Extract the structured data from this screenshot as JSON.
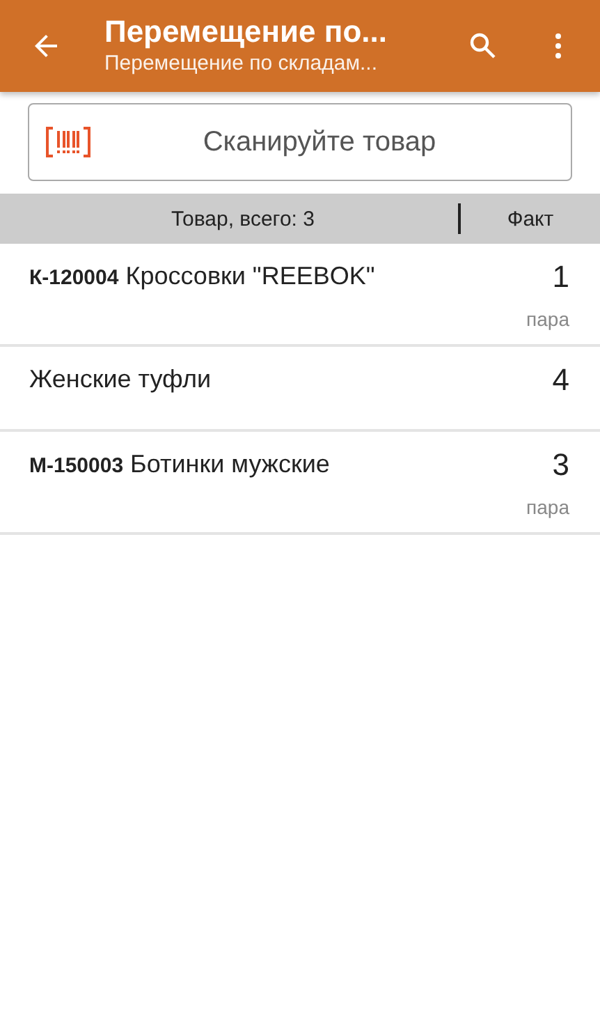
{
  "app_bar": {
    "title": "Перемещение по...",
    "subtitle": "Перемещение по складам..."
  },
  "scan_field": {
    "placeholder": "Сканируйте товар"
  },
  "table": {
    "columns": [
      "Товар, всего: 3",
      "Факт"
    ],
    "rows": [
      {
        "title": "**К-120004** Кроссовки \"REEBOK\"",
        "quantity": "1",
        "unit": "пара"
      },
      {
        "title": "Женские туфли",
        "quantity": "4"
      },
      {
        "title": "**М-150003** Ботинки мужские",
        "quantity": "3",
        "unit": "пара"
      }
    ]
  }
}
